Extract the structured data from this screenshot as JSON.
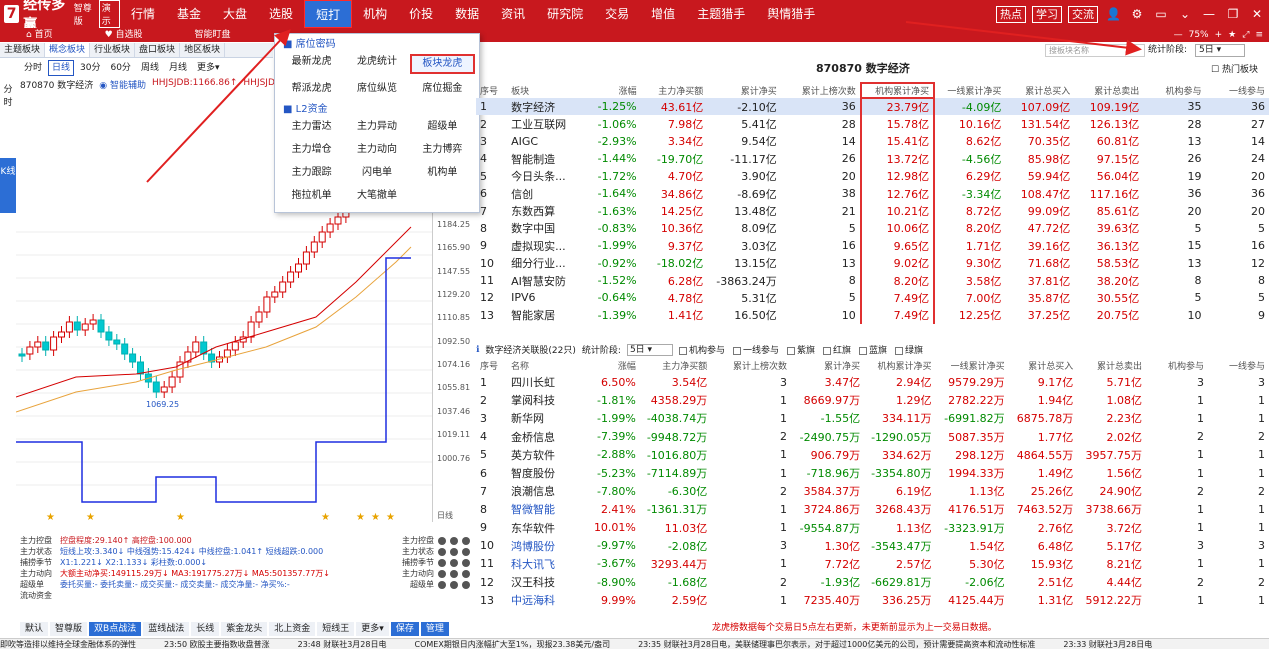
{
  "app": {
    "logo_mark": "7",
    "name": "经传多赢",
    "edition": "智尊版",
    "demo_btn": "演示"
  },
  "menu": [
    "行情",
    "基金",
    "大盘",
    "选股",
    "短打",
    "机构",
    "价投",
    "数据",
    "资讯",
    "研究院",
    "交易",
    "增值",
    "主题猎手",
    "舆情猎手"
  ],
  "menu_active": 4,
  "top_right": {
    "btn1": "热点",
    "btn2": "学习",
    "btn3": "交流"
  },
  "bar2": [
    "首页",
    "自选股",
    "智能盯盘"
  ],
  "zoom": "75%",
  "left_tabs": [
    "主题板块",
    "概念板块",
    "行业板块",
    "盘口板块",
    "地区板块"
  ],
  "period_tabs": [
    "分时",
    "日线",
    "30分",
    "60分",
    "周线",
    "月线",
    "更多▾"
  ],
  "side": {
    "a": "分时",
    "b": "K线"
  },
  "chart_title": {
    "code": "870870 数字经济",
    "assist": "智能辅助",
    "ma": "HHJSJDB:1166.86↑",
    "ma2": "HHJSJDC"
  },
  "price_axis": [
    "1184.25",
    "1165.90",
    "1147.55",
    "1129.20",
    "1110.85",
    "1092.50",
    "1074.16",
    "1055.81",
    "1037.46",
    "1019.11",
    "1000.76"
  ],
  "low_label": "1069.25",
  "month_label": "3月",
  "axis_unit": "日线",
  "indicators": [
    {
      "label": "主力控盘",
      "text": "控盘程度:29.140↑  高控盘:100.000",
      "right": "主力控盘"
    },
    {
      "label": "主力状态",
      "text": "短线上攻:3.340↓  中线强势:15.424↓  中线控盘:1.041↑  短线超跌:0.000",
      "right": "主力状态"
    },
    {
      "label": "捕捞季节",
      "text": "X1:1.221↓  X2:1.133↓  彩柱数:0.000↓",
      "right": "捕捞季节"
    },
    {
      "label": "主力动向",
      "text": "大额主动净买:149115.29万↓  MA3:191775.27万↓  MA5:501357.77万↓",
      "right": "主力动向"
    },
    {
      "label": "超级单",
      "text": "委托买量:-  委托卖量:-  成交买量:-  成交卖量:-  成交净量:-  净买%:-",
      "right": "超级单"
    },
    {
      "label": "流动资金",
      "text": "",
      "right": ""
    }
  ],
  "bottom_tabs": [
    "默认",
    "智尊版",
    "双B点战法",
    "蓝线战法",
    "长线",
    "紫金龙头",
    "北上资金",
    "短线王",
    "更多▾",
    "保存",
    "管理"
  ],
  "dropdown": {
    "sec1": "席位密码",
    "row1": [
      "最新龙虎",
      "龙虎统计",
      "板块龙虎"
    ],
    "row2": [
      "帮派龙虎",
      "席位纵览",
      "席位掘金"
    ],
    "sec2": "L2资金",
    "row3": [
      "主力雷达",
      "主力异动",
      "超级单"
    ],
    "row4": [
      "主力增仓",
      "主力动向",
      "主力博弈"
    ],
    "row5": [
      "主力跟踪",
      "闪电单",
      "机构单"
    ],
    "row6": [
      "拖拉机单",
      "大笔撤单"
    ]
  },
  "right_header": {
    "search": "搜板块名称",
    "stat_label": "统计阶段:",
    "stat_value": "5日",
    "title": "870870 数字经济",
    "hot": "热门板块"
  },
  "table1": {
    "headers": [
      "序号",
      "板块",
      "涨幅",
      "主力净买额",
      "累计净买",
      "累计上榜次数",
      "机构累计净买",
      "一线累计净买",
      "累计总买入",
      "累计总卖出",
      "机构参与",
      "一线参与"
    ],
    "rows": [
      [
        "1",
        "数字经济",
        "-1.25%",
        "43.61亿",
        "-2.10亿",
        "36",
        "23.79亿",
        "-4.09亿",
        "107.09亿",
        "109.19亿",
        "35",
        "36"
      ],
      [
        "2",
        "工业互联网",
        "-1.06%",
        "7.98亿",
        "5.41亿",
        "28",
        "15.78亿",
        "10.16亿",
        "131.54亿",
        "126.13亿",
        "28",
        "27"
      ],
      [
        "3",
        "AIGC",
        "-2.93%",
        "3.34亿",
        "9.54亿",
        "14",
        "15.41亿",
        "8.62亿",
        "70.35亿",
        "60.81亿",
        "13",
        "14"
      ],
      [
        "4",
        "智能制造",
        "-1.44%",
        "-19.70亿",
        "-11.17亿",
        "26",
        "13.72亿",
        "-4.56亿",
        "85.98亿",
        "97.15亿",
        "26",
        "24"
      ],
      [
        "5",
        "今日头条...",
        "-1.72%",
        "4.70亿",
        "3.90亿",
        "20",
        "12.98亿",
        "6.29亿",
        "59.94亿",
        "56.04亿",
        "19",
        "20"
      ],
      [
        "6",
        "信创",
        "-1.64%",
        "34.86亿",
        "-8.69亿",
        "38",
        "12.76亿",
        "-3.34亿",
        "108.47亿",
        "117.16亿",
        "36",
        "36"
      ],
      [
        "7",
        "东数西算",
        "-1.63%",
        "14.25亿",
        "13.48亿",
        "21",
        "10.21亿",
        "8.72亿",
        "99.09亿",
        "85.61亿",
        "20",
        "20"
      ],
      [
        "8",
        "数字中国",
        "-0.83%",
        "10.36亿",
        "8.09亿",
        "5",
        "10.06亿",
        "8.20亿",
        "47.72亿",
        "39.63亿",
        "5",
        "5"
      ],
      [
        "9",
        "虚拟现实...",
        "-1.99%",
        "9.37亿",
        "3.03亿",
        "16",
        "9.65亿",
        "1.71亿",
        "39.16亿",
        "36.13亿",
        "15",
        "16"
      ],
      [
        "10",
        "细分行业...",
        "-0.92%",
        "-18.02亿",
        "13.15亿",
        "13",
        "9.02亿",
        "9.30亿",
        "71.68亿",
        "58.53亿",
        "13",
        "12"
      ],
      [
        "11",
        "AI智慧安防",
        "-1.52%",
        "6.28亿",
        "-3863.24万",
        "8",
        "8.20亿",
        "3.58亿",
        "37.81亿",
        "38.20亿",
        "8",
        "8"
      ],
      [
        "12",
        "IPV6",
        "-0.64%",
        "4.78亿",
        "5.31亿",
        "5",
        "7.49亿",
        "7.00亿",
        "35.87亿",
        "30.55亿",
        "5",
        "5"
      ],
      [
        "13",
        "智能家居",
        "-1.39%",
        "1.41亿",
        "16.50亿",
        "10",
        "7.49亿",
        "12.25亿",
        "37.25亿",
        "20.75亿",
        "10",
        "9"
      ]
    ]
  },
  "sub_bar": {
    "title": "数字经济关联股(22只)",
    "stat_label": "统计阶段:",
    "stat_value": "5日",
    "checks": [
      "机构参与",
      "一线参与",
      "紫旗",
      "红旗",
      "蓝旗",
      "绿旗"
    ]
  },
  "table2": {
    "headers": [
      "序号",
      "名称",
      "涨幅",
      "主力净买额",
      "累计上榜次数",
      "累计净买",
      "机构累计净买",
      "一线累计净买",
      "累计总买入",
      "累计总卖出",
      "机构参与",
      "一线参与"
    ],
    "rows": [
      [
        "1",
        "四川长虹",
        "6.50%",
        "3.54亿",
        "3",
        "3.47亿",
        "2.94亿",
        "9579.29万",
        "9.17亿",
        "5.71亿",
        "3",
        "3"
      ],
      [
        "2",
        "掌阅科技",
        "-1.81%",
        "4358.29万",
        "1",
        "8669.97万",
        "1.29亿",
        "2782.22万",
        "1.94亿",
        "1.08亿",
        "1",
        "1"
      ],
      [
        "3",
        "新华网",
        "-1.99%",
        "-4038.74万",
        "1",
        "-1.55亿",
        "334.11万",
        "-6991.82万",
        "6875.78万",
        "2.23亿",
        "1",
        "1"
      ],
      [
        "4",
        "金桥信息",
        "-7.39%",
        "-9948.72万",
        "2",
        "-2490.75万",
        "-1290.05万",
        "5087.35万",
        "1.77亿",
        "2.02亿",
        "2",
        "2"
      ],
      [
        "5",
        "英方软件",
        "-2.88%",
        "-1016.80万",
        "1",
        "906.79万",
        "334.62万",
        "298.12万",
        "4864.55万",
        "3957.75万",
        "1",
        "1"
      ],
      [
        "6",
        "智度股份",
        "-5.23%",
        "-7114.89万",
        "1",
        "-718.96万",
        "-3354.80万",
        "1994.33万",
        "1.49亿",
        "1.56亿",
        "1",
        "1"
      ],
      [
        "7",
        "浪潮信息",
        "-7.80%",
        "-6.30亿",
        "2",
        "3584.37万",
        "6.19亿",
        "1.13亿",
        "25.26亿",
        "24.90亿",
        "2",
        "2"
      ],
      [
        "8",
        "智微智能",
        "2.41%",
        "-1361.31万",
        "1",
        "3724.86万",
        "3268.43万",
        "4176.51万",
        "7463.52万",
        "3738.66万",
        "1",
        "1"
      ],
      [
        "9",
        "东华软件",
        "10.01%",
        "11.03亿",
        "1",
        "-9554.87万",
        "1.13亿",
        "-3323.91万",
        "2.76亿",
        "3.72亿",
        "1",
        "1"
      ],
      [
        "10",
        "鸿博股份",
        "-9.97%",
        "-2.08亿",
        "3",
        "1.30亿",
        "-3543.47万",
        "1.54亿",
        "6.48亿",
        "5.17亿",
        "3",
        "3"
      ],
      [
        "11",
        "科大讯飞",
        "-3.67%",
        "3293.44万",
        "1",
        "7.72亿",
        "2.57亿",
        "5.30亿",
        "15.93亿",
        "8.21亿",
        "1",
        "1"
      ],
      [
        "12",
        "汉王科技",
        "-8.90%",
        "-1.68亿",
        "2",
        "-1.93亿",
        "-6629.81万",
        "-2.06亿",
        "2.51亿",
        "4.44亿",
        "2",
        "2"
      ],
      [
        "13",
        "中远海科",
        "9.99%",
        "2.59亿",
        "1",
        "7235.40万",
        "336.25万",
        "4125.44万",
        "1.31亿",
        "5912.22万",
        "1",
        "1"
      ]
    ]
  },
  "note": "龙虎榜数据每个交易日5点左右更新，未更新前显示为上一交易日数据。",
  "ticker": [
    "即吹等造排以维持全球金融体系的弹性",
    "23:50 欧股主要指数收盘普涨",
    "23:48 财联社3月28日电",
    "COMEX期银日内涨幅扩大至1%，现报23.38美元/盎司",
    "23:35 财联社3月28日电，美联储理事巴尔表示，对于超过1000亿美元的公司，预计需要提高资本和流动性标准",
    "23:33 财联社3月28日电"
  ],
  "colors": {
    "brand": "#c8181e",
    "accent": "#2c6ed5",
    "up": "#d40000",
    "down": "#008a00"
  }
}
